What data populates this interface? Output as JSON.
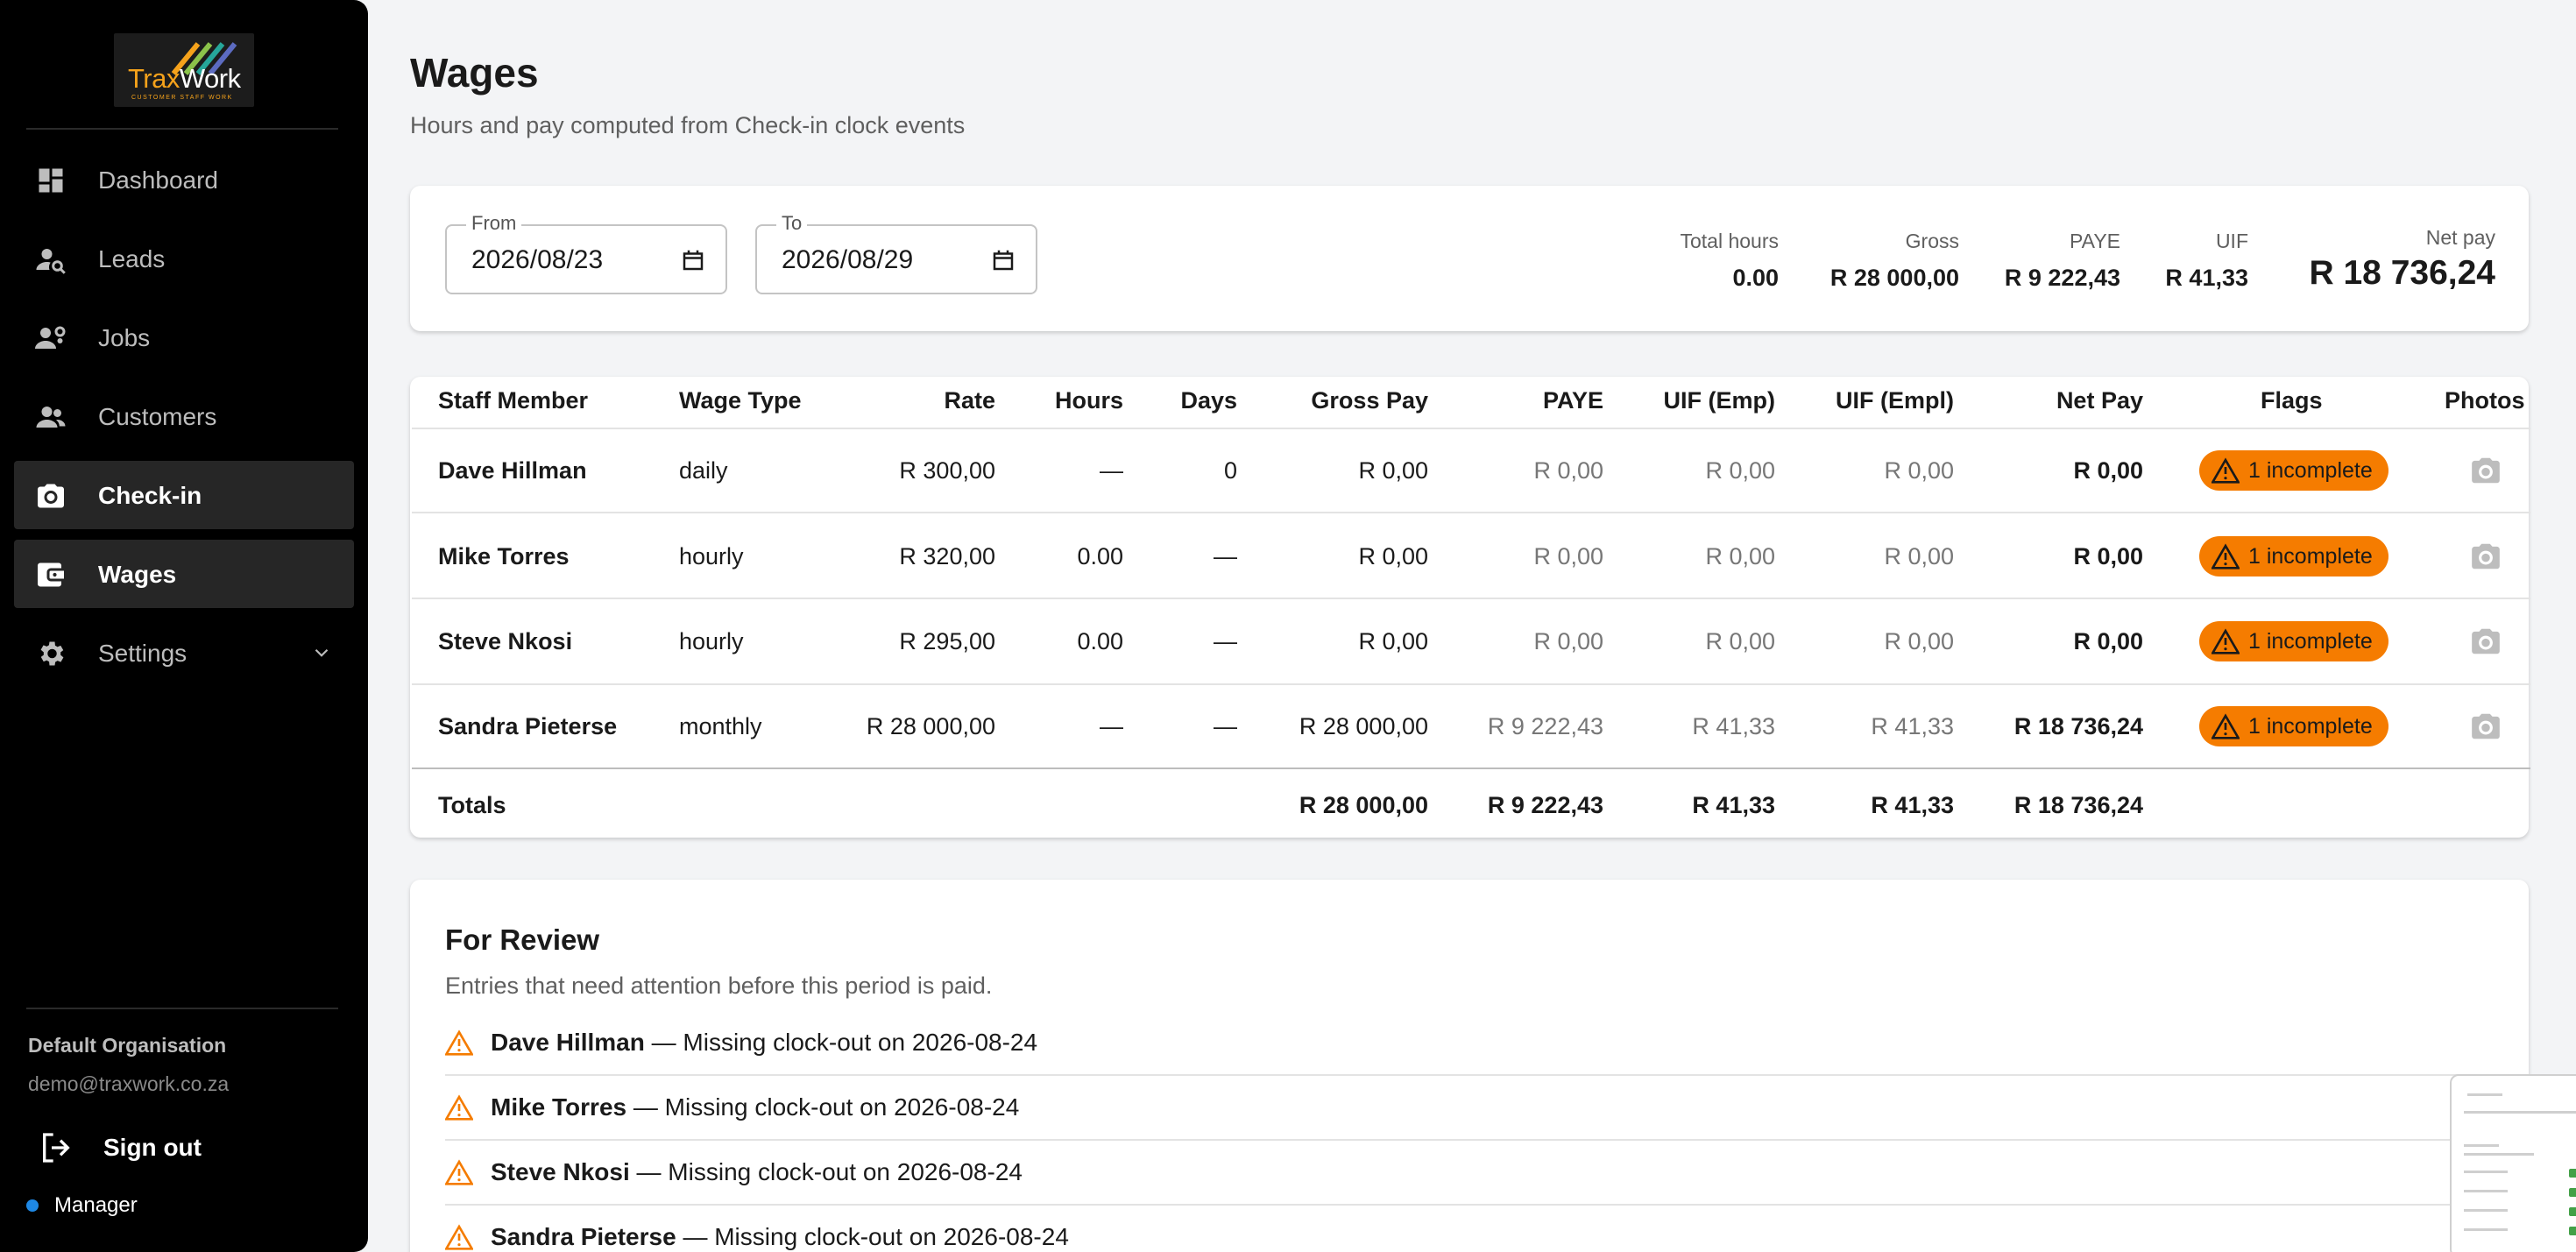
{
  "app": {
    "logo_text_a": "Trax",
    "logo_text_b": "Work",
    "logo_tagline": "CUSTOMER STAFF WORK"
  },
  "sidebar": {
    "items": [
      {
        "label": "Dashboard",
        "icon": "dashboard-icon",
        "active": false
      },
      {
        "label": "Leads",
        "icon": "person-search-icon",
        "active": false
      },
      {
        "label": "Jobs",
        "icon": "engineering-icon",
        "active": false
      },
      {
        "label": "Customers",
        "icon": "people-icon",
        "active": false
      },
      {
        "label": "Check-in",
        "icon": "camera-icon",
        "active": true
      },
      {
        "label": "Wages",
        "icon": "wallet-icon",
        "active": true
      },
      {
        "label": "Settings",
        "icon": "gear-icon",
        "active": false
      }
    ],
    "org_name": "Default Organisation",
    "org_email": "demo@traxwork.co.za",
    "signout_label": "Sign out",
    "role": "Manager"
  },
  "page": {
    "title": "Wages",
    "subtitle": "Hours and pay computed from Check-in clock events"
  },
  "filters": {
    "from_label": "From",
    "from_value": "2026/08/23",
    "to_label": "To",
    "to_value": "2026/08/29"
  },
  "summary": {
    "total_hours_label": "Total hours",
    "total_hours": "0.00",
    "gross_label": "Gross",
    "gross": "R 28 000,00",
    "paye_label": "PAYE",
    "paye": "R 9 222,43",
    "uif_label": "UIF",
    "uif": "R 41,33",
    "net_label": "Net pay",
    "net": "R 18 736,24"
  },
  "table": {
    "headers": [
      "Staff Member",
      "Wage Type",
      "Rate",
      "Hours",
      "Days",
      "Gross Pay",
      "PAYE",
      "UIF (Emp)",
      "UIF (Empl)",
      "Net Pay",
      "Flags",
      "Photos"
    ],
    "rows": [
      {
        "name": "Dave Hillman",
        "type": "daily",
        "rate": "R 300,00",
        "hours": "—",
        "days": "0",
        "gross": "R 0,00",
        "paye": "R 0,00",
        "uif_emp": "R 0,00",
        "uif_empl": "R 0,00",
        "net": "R 0,00",
        "flag": "1 incomplete"
      },
      {
        "name": "Mike Torres",
        "type": "hourly",
        "rate": "R 320,00",
        "hours": "0.00",
        "days": "—",
        "gross": "R 0,00",
        "paye": "R 0,00",
        "uif_emp": "R 0,00",
        "uif_empl": "R 0,00",
        "net": "R 0,00",
        "flag": "1 incomplete"
      },
      {
        "name": "Steve Nkosi",
        "type": "hourly",
        "rate": "R 295,00",
        "hours": "0.00",
        "days": "—",
        "gross": "R 0,00",
        "paye": "R 0,00",
        "uif_emp": "R 0,00",
        "uif_empl": "R 0,00",
        "net": "R 0,00",
        "flag": "1 incomplete"
      },
      {
        "name": "Sandra Pieterse",
        "type": "monthly",
        "rate": "R 28 000,00",
        "hours": "—",
        "days": "—",
        "gross": "R 28 000,00",
        "paye": "R 9 222,43",
        "uif_emp": "R 41,33",
        "uif_empl": "R 41,33",
        "net": "R 18 736,24",
        "flag": "1 incomplete"
      }
    ],
    "totals": {
      "label": "Totals",
      "gross": "R 28 000,00",
      "paye": "R 9 222,43",
      "uif_emp": "R 41,33",
      "uif_empl": "R 41,33",
      "net": "R 18 736,24"
    }
  },
  "review": {
    "title": "For Review",
    "subtitle": "Entries that need attention before this period is paid.",
    "items": [
      {
        "name": "Dave Hillman",
        "text": "— Missing clock-out on 2026-08-24"
      },
      {
        "name": "Mike Torres",
        "text": "— Missing clock-out on 2026-08-24"
      },
      {
        "name": "Steve Nkosi",
        "text": "— Missing clock-out on 2026-08-24"
      },
      {
        "name": "Sandra Pieterse",
        "text": "— Missing clock-out on 2026-08-24"
      }
    ]
  },
  "colors": {
    "sidebar_bg": "#000000",
    "active_nav": "#262626",
    "flag_orange": "#f57c00",
    "role_dot": "#1e88e5"
  }
}
